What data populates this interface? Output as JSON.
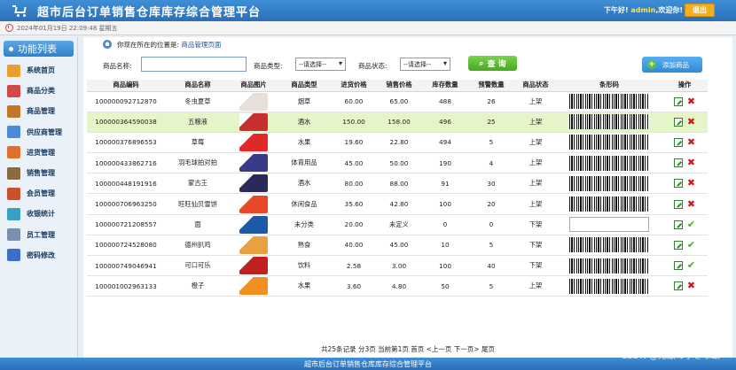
{
  "header": {
    "title": "超市后台订单销售仓库库存综合管理平台",
    "greeting_prefix": "下午好!",
    "username": "admin",
    "greeting_suffix": ",欢迎你!",
    "logout_label": "退出"
  },
  "datebar": {
    "datetime": "2024年01月19日 22:09:48 星期五"
  },
  "sidebar": {
    "title": "功能列表",
    "items": [
      {
        "label": "系统首页",
        "color": "#e8a030"
      },
      {
        "label": "商品分类",
        "color": "#d04848"
      },
      {
        "label": "商品管理",
        "color": "#c07828"
      },
      {
        "label": "供应商管理",
        "color": "#4a8ad8"
      },
      {
        "label": "进货管理",
        "color": "#e07030"
      },
      {
        "label": "销售管理",
        "color": "#8a6a40"
      },
      {
        "label": "会员管理",
        "color": "#c8502a"
      },
      {
        "label": "收银统计",
        "color": "#3aa0c0"
      },
      {
        "label": "员工管理",
        "color": "#7a90b0"
      },
      {
        "label": "密码修改",
        "color": "#3a70c8"
      }
    ]
  },
  "location": {
    "prefix": "你现在所在的位置是:",
    "page": "商品管理页面"
  },
  "filter": {
    "name_label": "商品名称:",
    "type_label": "商品类型:",
    "type_value": "--请选择--",
    "status_label": "商品状态:",
    "status_value": "--请选择--",
    "query_label": "查 询",
    "add_label": "添加商品"
  },
  "table": {
    "headers": [
      "商品编码",
      "商品名称",
      "商品图片",
      "商品类型",
      "进货价格",
      "销售价格",
      "库存数量",
      "预警数量",
      "商品状态",
      "条形码",
      "操作"
    ],
    "rows": [
      {
        "code": "100000092712870",
        "name": "冬虫夏草",
        "type": "烟草",
        "buy": "60.00",
        "sell": "65.00",
        "stock": "488",
        "warn": "26",
        "status": "上架",
        "img": "#e8e0d8",
        "barcode": true,
        "enabled": false
      },
      {
        "code": "100000364590038",
        "name": "五粮液",
        "type": "酒水",
        "buy": "150.00",
        "sell": "158.00",
        "stock": "496",
        "warn": "25",
        "status": "上架",
        "img": "#c83030",
        "barcode": true,
        "enabled": false
      },
      {
        "code": "100000376896553",
        "name": "草莓",
        "type": "水果",
        "buy": "19.60",
        "sell": "22.80",
        "stock": "494",
        "warn": "5",
        "status": "上架",
        "img": "#e02828",
        "barcode": true,
        "enabled": false
      },
      {
        "code": "100000433862716",
        "name": "羽毛球拍对拍",
        "type": "体育用品",
        "buy": "45.00",
        "sell": "50.00",
        "stock": "190",
        "warn": "4",
        "status": "上架",
        "img": "#3a3a8a",
        "barcode": true,
        "enabled": false
      },
      {
        "code": "100000448191916",
        "name": "蒙古王",
        "type": "酒水",
        "buy": "80.00",
        "sell": "88.00",
        "stock": "91",
        "warn": "30",
        "status": "上架",
        "img": "#2a2a5a",
        "barcode": true,
        "enabled": false
      },
      {
        "code": "100000706963250",
        "name": "旺旺仙贝雪饼",
        "type": "休闲食品",
        "buy": "35.60",
        "sell": "42.80",
        "stock": "100",
        "warn": "20",
        "status": "上架",
        "img": "#e84828",
        "barcode": true,
        "enabled": false
      },
      {
        "code": "100000721208557",
        "name": "面",
        "type": "未分类",
        "buy": "20.00",
        "sell": "未定义",
        "stock": "0",
        "warn": "0",
        "status": "下架",
        "img": "#1a5aa8",
        "barcode": false,
        "enabled": true
      },
      {
        "code": "100000724528080",
        "name": "德州扒鸡",
        "type": "熟食",
        "buy": "40.00",
        "sell": "45.00",
        "stock": "10",
        "warn": "5",
        "status": "下架",
        "img": "#e8a040",
        "barcode": true,
        "enabled": true
      },
      {
        "code": "100000749046941",
        "name": "可口可乐",
        "type": "饮料",
        "buy": "2.58",
        "sell": "3.00",
        "stock": "100",
        "warn": "40",
        "status": "下架",
        "img": "#c02020",
        "barcode": true,
        "enabled": true
      },
      {
        "code": "100001002963133",
        "name": "橙子",
        "type": "水果",
        "buy": "3.60",
        "sell": "4.80",
        "stock": "50",
        "warn": "5",
        "status": "上架",
        "img": "#f09020",
        "barcode": true,
        "enabled": false
      }
    ]
  },
  "pager": {
    "text": "共25条记录   分3页   当前第1页   首页   <上一页   下一页>   尾页"
  },
  "footer": {
    "text": "超市后台订单销售仓库库存综合管理平台"
  },
  "watermark": {
    "text": "CSDN @无敌の小さな蚊"
  }
}
